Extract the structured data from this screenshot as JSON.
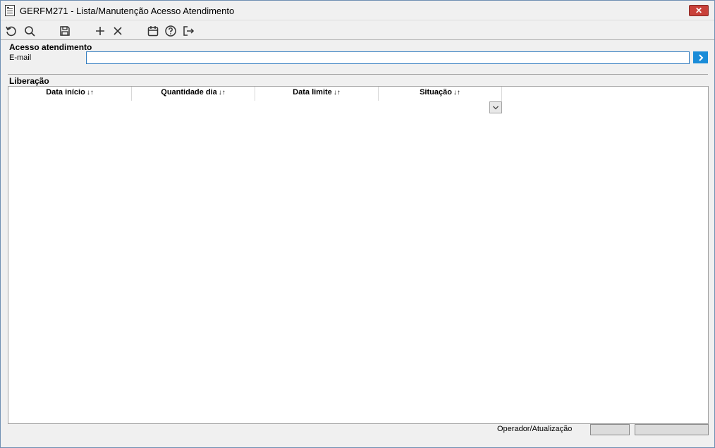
{
  "window": {
    "title": "GERFM271 - Lista/Manutenção Acesso Atendimento",
    "close_label": "✕"
  },
  "toolbar": {
    "buttons": [
      {
        "name": "refresh-icon"
      },
      {
        "name": "search-icon"
      },
      {
        "name": "save-icon"
      },
      {
        "name": "add-icon"
      },
      {
        "name": "delete-icon"
      },
      {
        "name": "calendar-icon"
      },
      {
        "name": "help-icon"
      },
      {
        "name": "exit-icon"
      }
    ]
  },
  "acesso": {
    "section_title": "Acesso atendimento",
    "email_label": "E-mail",
    "email_value": "",
    "go_icon": "chevron-right-icon"
  },
  "liberacao": {
    "section_title": "Liberação",
    "columns": [
      {
        "label": "Data início",
        "sort": "↓↑"
      },
      {
        "label": "Quantidade dia",
        "sort": "↓↑"
      },
      {
        "label": "Data limite",
        "sort": "↓↑"
      },
      {
        "label": "Situação",
        "sort": "↓↑"
      }
    ],
    "rows": []
  },
  "status": {
    "label": "Operador/Atualização",
    "operador": "",
    "atualizacao": ""
  },
  "colors": {
    "accent": "#1a8cd8",
    "close": "#c9413a"
  }
}
